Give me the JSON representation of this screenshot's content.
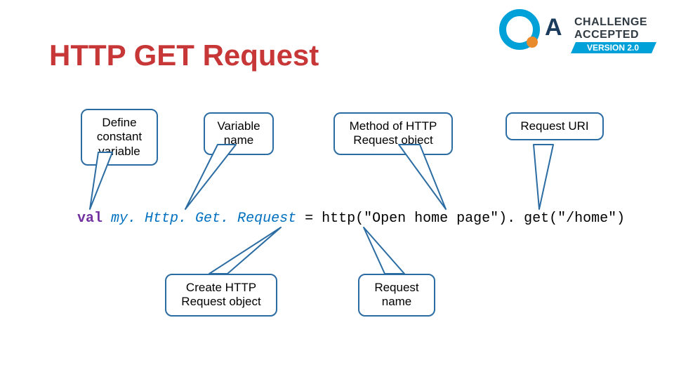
{
  "title": "HTTP GET Request",
  "logo": {
    "brand_primary": "QA",
    "ring_color": "#00a0d8",
    "dot_color": "#e88b2d",
    "tag_line1": "CHALLENGE",
    "tag_line2": "ACCEPTED",
    "version_label": "VERSION 2.0",
    "version_bg": "#00a0d8"
  },
  "bubbles": {
    "define": "Define constant variable",
    "varname": "Variable name",
    "method": "Method of HTTP Request object",
    "uri": "Request URI",
    "create": "Create HTTP Request object",
    "reqname": "Request name"
  },
  "code": {
    "keyword": "val",
    "ident": "my. Http. Get. Request",
    "rest": " = http(\"Open home page\"). get(\"/home\")"
  }
}
